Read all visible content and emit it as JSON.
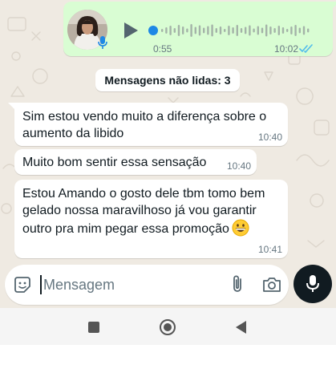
{
  "voice_message": {
    "duration": "0:55",
    "time": "10:02",
    "progress": 0,
    "status": "read",
    "colors": {
      "bubble": "#d9fdd3",
      "accent": "#1e88e5",
      "ticks": "#53bdeb"
    }
  },
  "unread_banner": {
    "label": "Mensagens não lidas: 3"
  },
  "messages": [
    {
      "text": "Sim estou vendo muito a diferença sobre o aumento da libido",
      "time": "10:40"
    },
    {
      "text": "Muito bom sentir essa sensação",
      "time": "10:40"
    },
    {
      "text": "Estou Amando o gosto dele tbm tomo bem gelado nossa maravilhoso já vou garantir outro pra mim pegar essa promoção",
      "time": "10:41",
      "emoji": "grinning-face"
    }
  ],
  "composer": {
    "placeholder": "Mensagem",
    "icons": [
      "emoji-icon",
      "paperclip-icon",
      "camera-icon",
      "microphone-icon"
    ]
  },
  "nav": {
    "icons": [
      "recents-square-icon",
      "home-circle-icon",
      "back-triangle-icon"
    ]
  }
}
